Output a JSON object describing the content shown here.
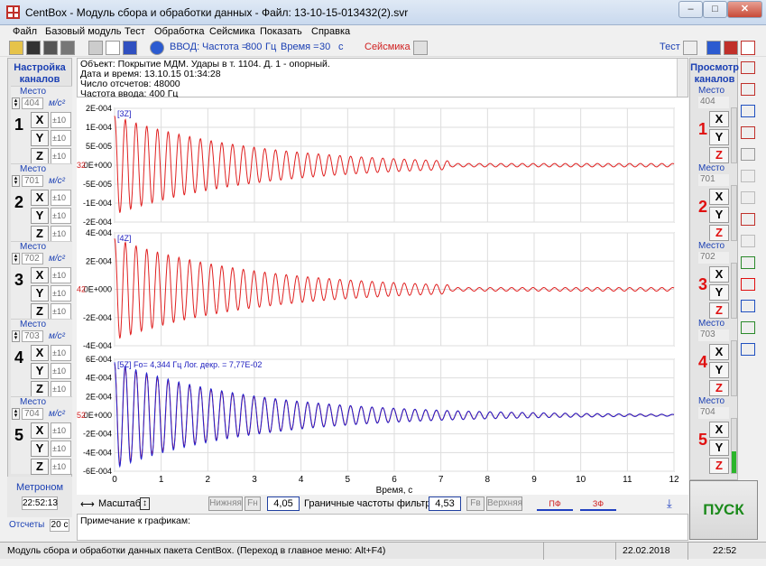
{
  "window": {
    "title": "CentBox - Модуль сбора и обработки данных - Файл: 13-10-15-013432(2).svr"
  },
  "menu": [
    "Файл",
    "Базовый модуль",
    "Тест",
    "Обработка",
    "Сейсмика",
    "Показать",
    "Справка"
  ],
  "toolbar": {
    "input_label": "ВВОД:",
    "freq_label": "Частота =",
    "freq_value": "800",
    "freq_unit": "Гц",
    "time_label": "Время =",
    "time_value": "30",
    "time_unit": "с",
    "seismic_label": "Сейсмика",
    "test_label": "Тест"
  },
  "left_panel": {
    "title": "Настройка каналов",
    "place_label": "Место",
    "unit": "м/с²",
    "channels": [
      {
        "num": "1",
        "place": "404",
        "ranges": [
          "±10",
          "±10",
          "±10"
        ]
      },
      {
        "num": "2",
        "place": "701",
        "ranges": [
          "±10",
          "±10",
          "±10"
        ]
      },
      {
        "num": "3",
        "place": "702",
        "ranges": [
          "±10",
          "±10",
          "±10"
        ]
      },
      {
        "num": "4",
        "place": "703",
        "ranges": [
          "±10",
          "±10",
          "±10"
        ]
      },
      {
        "num": "5",
        "place": "704",
        "ranges": [
          "±10",
          "±10",
          "±10"
        ]
      }
    ],
    "axes": [
      "X",
      "Y",
      "Z"
    ],
    "metronome_label": "Метроном",
    "metronome_time": "22:52:13",
    "counts_label": "Отсчеты",
    "counts_value": "20 с"
  },
  "info": {
    "object": "Объект: Покрытие МДМ. Удары в т. 1104. Д. 1 - опорный.",
    "datetime": "Дата и время: 13.10.15  01:34:28",
    "samples": "Число отсчетов: 48000",
    "rate": "Частота ввода: 400 Гц"
  },
  "right_panel": {
    "title": "Просмотр каналов",
    "place_label": "Место",
    "channels": [
      {
        "num": "1",
        "place": "404",
        "selected": "Z"
      },
      {
        "num": "2",
        "place": "701",
        "selected": "Z"
      },
      {
        "num": "3",
        "place": "702",
        "selected": "Z"
      },
      {
        "num": "4",
        "place": "703",
        "selected": "Z"
      },
      {
        "num": "5",
        "place": "704",
        "selected": "Z"
      }
    ],
    "axes": [
      "X",
      "Y",
      "Z"
    ]
  },
  "chart_data": [
    {
      "type": "line",
      "channel_label": "[3Z]",
      "zero_label": "32",
      "ylim": [
        -0.00015,
        0.00015
      ],
      "yticks": [
        "2E-004",
        "1E-004",
        "5E-005",
        "0E+000",
        "-5E-005",
        "-1E-004",
        "-2E-004"
      ],
      "series": [
        {
          "color": "#e02020",
          "amplitude": 0.00013,
          "freq_hz": 4.344,
          "log_decrement": 0.0777
        }
      ]
    },
    {
      "type": "line",
      "channel_label": "[4Z]",
      "zero_label": "42",
      "ylim": [
        -0.0004,
        0.0004
      ],
      "yticks": [
        "4E-004",
        "2E-004",
        "0E+000",
        "-2E-004",
        "-4E-004"
      ],
      "series": [
        {
          "color": "#e02020",
          "amplitude": 0.00036,
          "freq_hz": 4.344,
          "log_decrement": 0.0777
        }
      ]
    },
    {
      "type": "line",
      "channel_label": "[5Z]",
      "annotation": "Fo= 4,344 Гц  Лог. декр. = 7,77E-02",
      "zero_label": "52",
      "ylim": [
        -0.0006,
        0.0006
      ],
      "yticks": [
        "6E-004",
        "4E-004",
        "2E-004",
        "0E+000",
        "-2E-004",
        "-4E-004",
        "-6E-004"
      ],
      "xlabel": "Время, с",
      "xlim": [
        0,
        12
      ],
      "xticks": [
        "0",
        "1",
        "2",
        "3",
        "4",
        "5",
        "6",
        "7",
        "8",
        "9",
        "10",
        "11",
        "12"
      ],
      "series": [
        {
          "color": "#e02020",
          "amplitude": 0.00055,
          "freq_hz": 4.344,
          "log_decrement": 0.0777
        },
        {
          "color": "#2020d0",
          "amplitude": 0.00057,
          "freq_hz": 4.344,
          "log_decrement": 0.0777
        }
      ]
    }
  ],
  "filter_bar": {
    "scale_label": "Масштаб",
    "lower_label": "Нижняя",
    "lower_sym": "Fн",
    "lower_value": "4,05",
    "filter_label": "Граничные частоты фильтра, Гц",
    "upper_value": "4,53",
    "upper_sym": "Fв",
    "upper_label": "Верхняя",
    "pf_label": "ПФ",
    "zf_label": "ЗФ"
  },
  "notes_label": "Примечание к графикам:",
  "start_button": "ПУСК",
  "status": {
    "text": "Модуль сбора и обработки данных пакета CentBox. (Переход в главное меню: Alt+F4)",
    "date": "22.02.2018",
    "time": "22:52"
  }
}
